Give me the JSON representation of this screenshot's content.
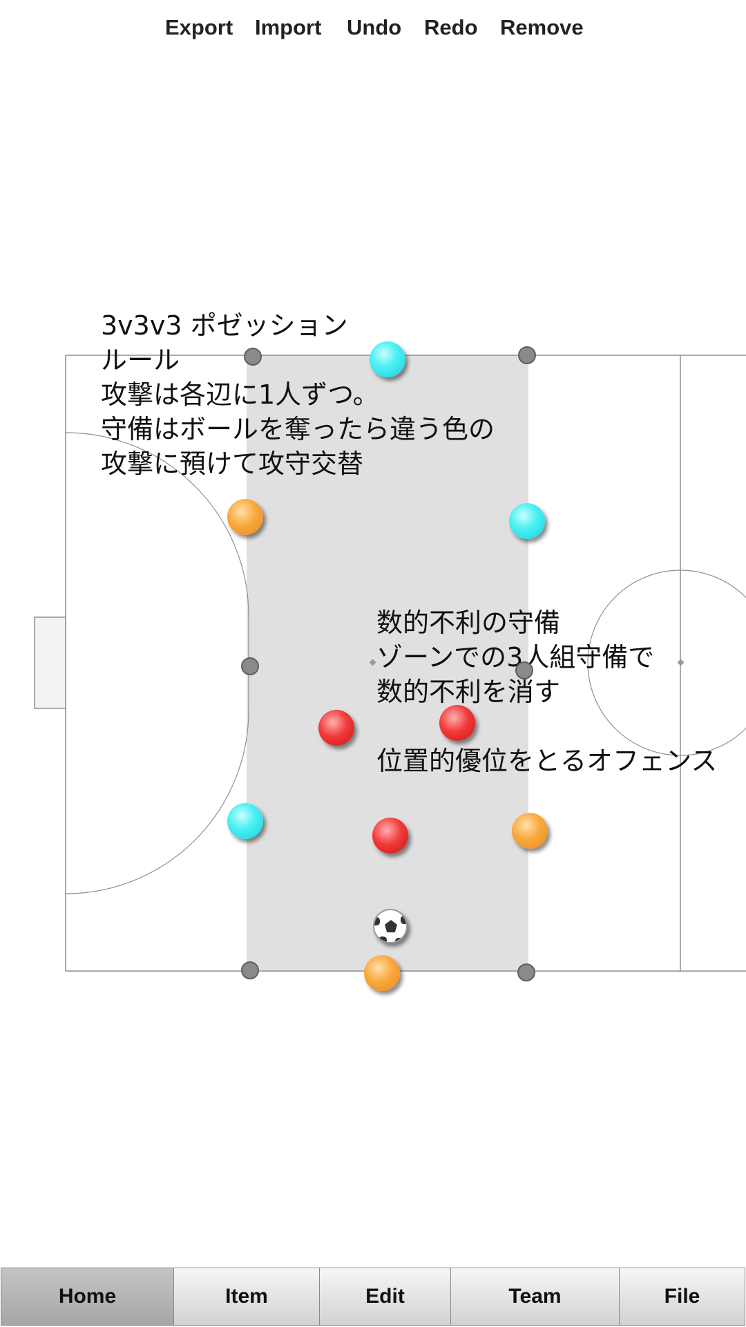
{
  "toolbar": {
    "export_label": "Export",
    "import_label": "Import",
    "undo_label": "Undo",
    "redo_label": "Redo",
    "remove_label": "Remove"
  },
  "notes": {
    "drill_rules": [
      "3v3v3 ポゼッション",
      "ルール",
      "攻撃は各辺に1人ずつ。",
      "守備はボールを奪ったら違う色の",
      "攻撃に預けて攻守交替"
    ],
    "tactics": [
      "数的不利の守備",
      "ゾーンでの3人組守備で",
      "数的不利を消す",
      "",
      "位置的優位をとるオフェンス"
    ]
  },
  "colors": {
    "team_cyan": "#2fe6ea",
    "team_orange": "#f5a03a",
    "team_red": "#e82b2b",
    "zone_fill": "#e0e0e0",
    "line": "#8f8f8f"
  },
  "tabs": [
    {
      "label": "Home",
      "active": true
    },
    {
      "label": "Item",
      "active": false
    },
    {
      "label": "Edit",
      "active": false
    },
    {
      "label": "Team",
      "active": false
    },
    {
      "label": "File",
      "active": false
    }
  ]
}
